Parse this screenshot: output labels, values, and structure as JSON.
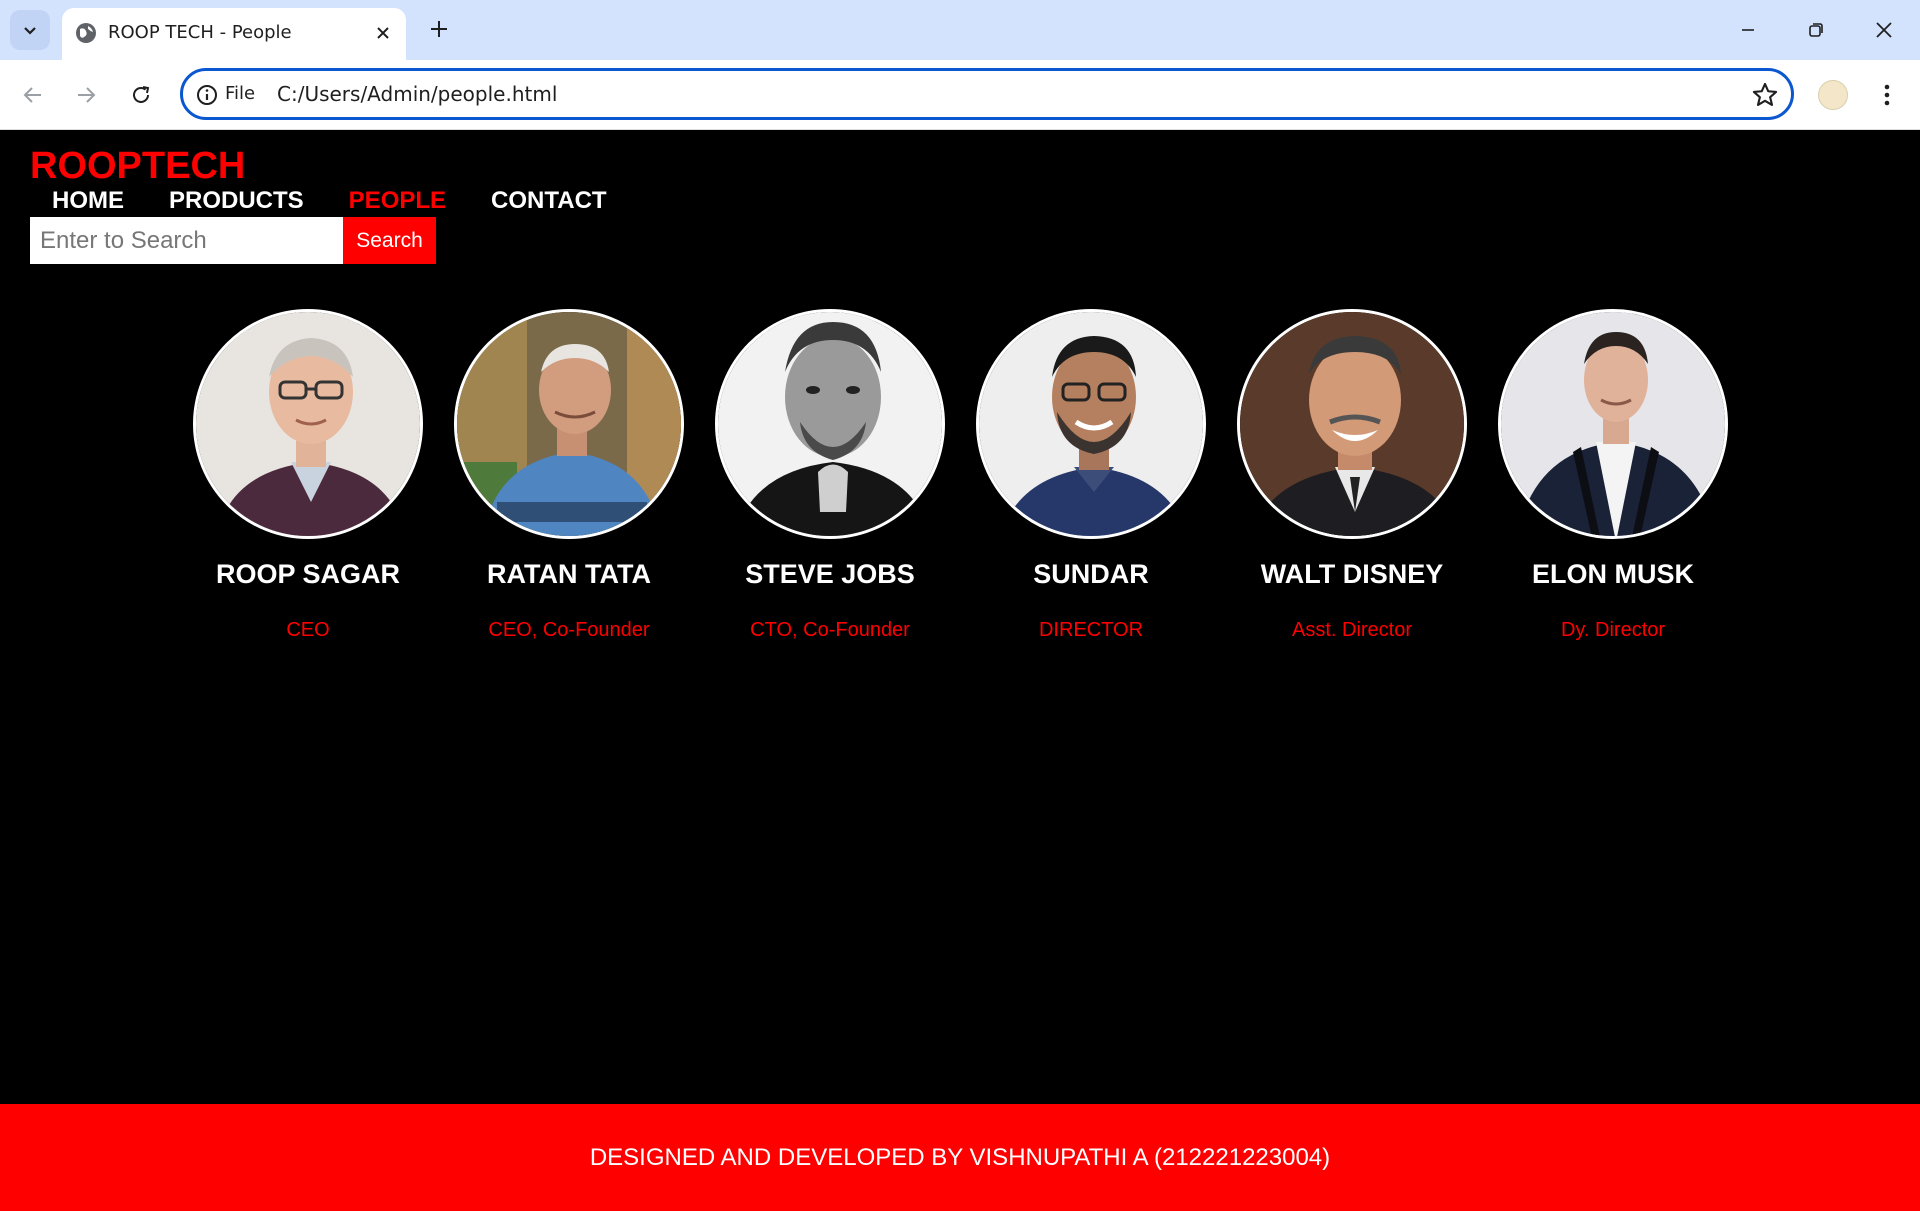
{
  "browser": {
    "tab_title": "ROOP TECH - People",
    "address_scheme": "File",
    "address_url": "C:/Users/Admin/people.html"
  },
  "site": {
    "brand": "ROOPTECH",
    "nav": [
      "HOME",
      "PRODUCTS",
      "PEOPLE",
      "CONTACT"
    ],
    "active_nav": "PEOPLE",
    "search_placeholder": "Enter to Search",
    "search_button": "Search",
    "accent_color": "#ff0000"
  },
  "people": [
    {
      "name": "ROOP SAGAR",
      "role": "CEO"
    },
    {
      "name": "RATAN TATA",
      "role": "CEO, Co-Founder"
    },
    {
      "name": "STEVE JOBS",
      "role": "CTO, Co-Founder"
    },
    {
      "name": "SUNDAR",
      "role": "DIRECTOR"
    },
    {
      "name": "WALT DISNEY",
      "role": "Asst. Director"
    },
    {
      "name": "ELON MUSK",
      "role": "Dy. Director"
    }
  ],
  "footer": "DESIGNED AND DEVELOPED BY VISHNUPATHI A (212221223004)"
}
